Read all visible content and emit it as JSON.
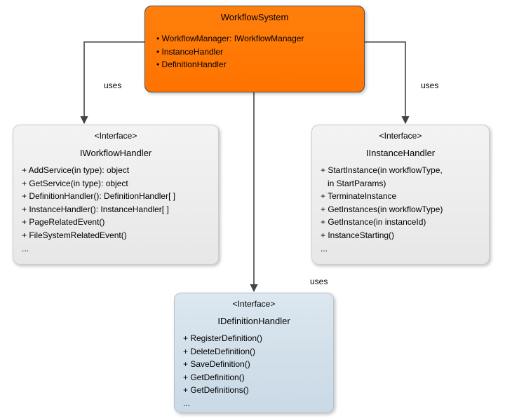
{
  "top": {
    "title": "WorkflowSystem",
    "bullets": [
      "WorkflowManager: IWorkflowManager",
      "InstanceHandler",
      "DefinitionHandler"
    ]
  },
  "left": {
    "stereo": "<Interface>",
    "name": "IWorkflowHandler",
    "members": [
      "+ AddService(in type): object",
      "+ GetService(in type): object",
      "+ DefinitionHandler(): DefinitionHandler[ ]",
      "+ InstanceHandler(): InstanceHandler[ ]",
      "+ PageRelatedEvent()",
      "+ FileSystemRelatedEvent()",
      "..."
    ]
  },
  "right": {
    "stereo": "<Interface>",
    "name": "IInstanceHandler",
    "members": [
      "+ StartInstance(in workflowType,",
      "   in StartParams)",
      "+ TerminateInstance",
      "+ GetInstances(in workflowType)",
      "+ GetInstance(in instanceId)",
      "+ InstanceStarting()",
      "..."
    ]
  },
  "bottom": {
    "stereo": "<Interface>",
    "name": "IDefinitionHandler",
    "members": [
      "+ RegisterDefinition()",
      "+ DeleteDefinition()",
      "+ SaveDefinition()",
      "+ GetDefinition()",
      "+ GetDefinitions()",
      "..."
    ]
  },
  "edges": {
    "left": "uses",
    "right": "uses",
    "bottom": "uses"
  }
}
